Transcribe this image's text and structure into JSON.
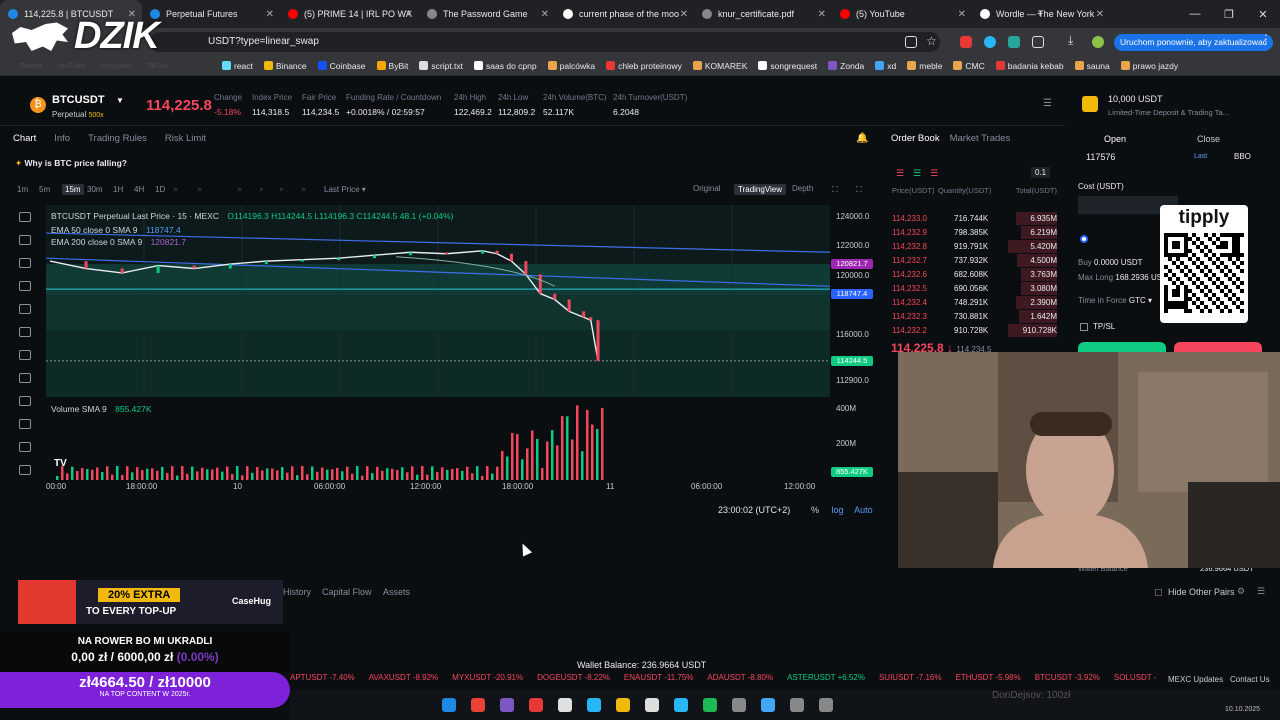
{
  "browser": {
    "tabs": [
      {
        "title": "114,225.8 | BTCUSDT",
        "icon": "mexc-icon",
        "color": "#1e88e5"
      },
      {
        "title": "Perpetual Futures",
        "icon": "mexc-icon",
        "color": "#1e88e5"
      },
      {
        "title": "(5) PRIME 14 | IRL PO WA",
        "icon": "youtube-icon",
        "color": "#ff0000"
      },
      {
        "title": "The Password Game",
        "icon": "globe-icon",
        "color": "#888888"
      },
      {
        "title": "current phase of the moo",
        "icon": "google-icon",
        "color": "#ffffff"
      },
      {
        "title": "knur_certificate.pdf",
        "icon": "pdf-icon",
        "color": "#888888"
      },
      {
        "title": "(5) YouTube",
        "icon": "youtube-icon",
        "color": "#ff0000"
      },
      {
        "title": "Wordle — The New York",
        "icon": "wordle-icon",
        "color": "#ffffff"
      }
    ],
    "url": "USDT?type=linear_swap",
    "update_button": "Uruchom ponownie, aby zaktualizować",
    "bookmarks": [
      "react",
      "Binance",
      "Coinbase",
      "ByBit",
      "script.txt",
      "saas do cpnp",
      "palcówka",
      "chleb proteinowy",
      "KOMAREK",
      "songrequest",
      "Zonda",
      "xd",
      "meble",
      "CMC",
      "badania kebab",
      "sauna",
      "prawo jazdy"
    ],
    "faded_bookmarks": [
      "Twitter",
      "YouTube",
      "Instagram",
      "TikTok"
    ]
  },
  "overlay": {
    "logo": "DZIK",
    "promo_text": "20% EXTRA",
    "promo_sub": "TO EVERY TOP-UP",
    "promo_brand": "CaseHug",
    "goal_title": "NA ROWER BO MI UKRADLI",
    "goal_progress": "0,00 zł",
    "goal_target": "6000,00 zł",
    "goal_pct": "(0.00%)",
    "goal_bar_text": "zł4664.50 / zł10000",
    "goal_bar_sub": "NA TOP CONTENT W 2025r.",
    "qr_brand": "tipply",
    "donation": "DonDejsov: 100zł"
  },
  "ticker": {
    "symbol": "BTCUSDT",
    "type": "Perpetual",
    "leverage": "500x",
    "last_price": "114,225.8",
    "stats": [
      {
        "label": "Change",
        "value": "-5.18%"
      },
      {
        "label": "Index Price",
        "value": "114,318.5"
      },
      {
        "label": "Fair Price",
        "value": "114,234.5"
      },
      {
        "label": "Funding Rate / Countdown",
        "value": "+0.0018% / 02:59:57"
      },
      {
        "label": "24h High",
        "value": "122,469.2"
      },
      {
        "label": "24h Low",
        "value": "112,809.2"
      },
      {
        "label": "24h Volume(BTC)",
        "value": "52.117K"
      },
      {
        "label": "24h Turnover(USDT)",
        "value": "6.2048"
      }
    ]
  },
  "chart_panel": {
    "tabs": [
      "Chart",
      "Info",
      "Trading Rules",
      "Risk Limit"
    ],
    "question": "Why is BTC price falling?",
    "timeframes": [
      "1m",
      "5m",
      "15m",
      "30m",
      "1H",
      "4H",
      "1D"
    ],
    "active_tf": "15m",
    "price_type": "Last Price",
    "views": [
      "Original",
      "TradingView",
      "Depth"
    ],
    "active_view": "TradingView",
    "legend_title": "BTCUSDT Perpetual Last Price · 15 · MEXC",
    "legend_ohlc": "O114196.3 H114244.5 L114196.3 C114244.5 48.1 (+0.04%)",
    "ema50": "EMA 50 close 0 SMA 9",
    "ema50_val": "118747.4",
    "ema200": "EMA 200 close 0 SMA 9",
    "ema200_val": "120821.7",
    "volume_label": "Volume SMA 9",
    "volume_val": "855.427K",
    "clock": "23:00:02 (UTC+2)",
    "scale_opts": [
      "%",
      "log",
      "Auto"
    ]
  },
  "chart_data": {
    "type": "line",
    "title": "BTCUSDT Perpetual Last Price · 15 · MEXC",
    "ylim": [
      111800,
      124800
    ],
    "yticks": [
      "124000.0",
      "122000.0",
      "120000.0",
      "116000.0",
      "112900.0"
    ],
    "ytags": [
      {
        "label": "120821.7",
        "value": 120821.7,
        "color": "#9c27b0"
      },
      {
        "label": "118747.4",
        "value": 118747.4,
        "color": "#2962ff"
      },
      {
        "label": "114244.5",
        "value": 114244.5,
        "color": "#0ecb81"
      }
    ],
    "xticks": [
      "00:00",
      "18:00:00",
      "10",
      "06:00:00",
      "12:00:00",
      "18:00:00",
      "11",
      "06:00:00",
      "12:00:00"
    ],
    "x": [
      0,
      5,
      10,
      15,
      20,
      25,
      30,
      35,
      40,
      45,
      50,
      55,
      60,
      62,
      64,
      66,
      68,
      70,
      72,
      74,
      75,
      76
    ],
    "series": [
      {
        "values": [
          121000,
          120500,
          120200,
          120700,
          120500,
          120800,
          121000,
          121100,
          121200,
          121400,
          121600,
          121500,
          121700,
          121500,
          121000,
          120100,
          118800,
          118400,
          117600,
          117200,
          117000,
          114244
        ]
      }
    ],
    "volume_ylim": [
      0,
      450
    ],
    "volume_yticks": [
      "400M",
      "200M"
    ],
    "volume_tag": "855.427K"
  },
  "orderbook": {
    "tabs": [
      "Order Book",
      "Market Trades"
    ],
    "precision": "0.1",
    "headers": [
      "Price(USDT)",
      "Quantity(USDT)",
      "Total(USDT)"
    ],
    "asks": [
      {
        "p": "114,233.0",
        "q": "716.744K",
        "t": "6.935M",
        "fill": 0.25
      },
      {
        "p": "114,232.9",
        "q": "798.385K",
        "t": "6.219M",
        "fill": 0.22
      },
      {
        "p": "114,232.8",
        "q": "919.791K",
        "t": "5.420M",
        "fill": 0.3
      },
      {
        "p": "114,232.7",
        "q": "737.932K",
        "t": "4.500M",
        "fill": 0.24
      },
      {
        "p": "114,232.6",
        "q": "682.608K",
        "t": "3.763M",
        "fill": 0.22
      },
      {
        "p": "114,232.5",
        "q": "690.056K",
        "t": "3.080M",
        "fill": 0.22
      },
      {
        "p": "114,232.4",
        "q": "748.291K",
        "t": "2.390M",
        "fill": 0.25
      },
      {
        "p": "114,232.3",
        "q": "730.881K",
        "t": "1.642M",
        "fill": 0.23
      },
      {
        "p": "114,232.2",
        "q": "910.728K",
        "t": "910.728K",
        "fill": 0.3
      }
    ],
    "mid": "114,225.8 ↓",
    "mid_sub": "114,234.5"
  },
  "trade_panel": {
    "promo_title": "10,000 USDT",
    "promo_sub": "Limited-Time Deposit & Trading Ta...",
    "tabs": [
      "Open",
      "Close"
    ],
    "price": "117576",
    "bbo": "BBO",
    "last": "Last",
    "cost": "Cost (USDT)",
    "buy": "Buy",
    "buy_val": "0.0000 USDT",
    "max_long": "Max Long",
    "max_long_val": "168.2936 USDT",
    "tif": "Time in Force",
    "tif_val": "GTC",
    "tpsl": "TP/SL",
    "wallet_label": "Wallet Balance",
    "wallet_val": "236.9664 USDT"
  },
  "bottom": {
    "tabs": [
      "History",
      "Capital Flow",
      "Assets"
    ],
    "hide_pairs": "Hide Other Pairs",
    "wallet": "Wallet Balance: 236.9664 USDT",
    "marquee": [
      {
        "t": "APTUSDT -7.40%",
        "c": "#f6465d"
      },
      {
        "t": "AVAXUSDT -8.92%",
        "c": "#f6465d"
      },
      {
        "t": "MYXUSDT -20.91%",
        "c": "#f6465d"
      },
      {
        "t": "DOGEUSDT -8.22%",
        "c": "#f6465d"
      },
      {
        "t": "ENAUSDT -11.75%",
        "c": "#f6465d"
      },
      {
        "t": "ADAUSDT -8.80%",
        "c": "#f6465d"
      },
      {
        "t": "ASTERUSDT +6.52%",
        "c": "#0ecb81"
      },
      {
        "t": "SUIUSDT -7.16%",
        "c": "#f6465d"
      },
      {
        "t": "ETHUSDT -5.98%",
        "c": "#f6465d"
      },
      {
        "t": "BTCUSDT -3.92%",
        "c": "#f6465d"
      },
      {
        "t": "SOLUSDT -",
        "c": "#f6465d"
      }
    ],
    "updates": "MEXC Updates",
    "contact": "Contact Us",
    "date": "10.10.2025"
  }
}
